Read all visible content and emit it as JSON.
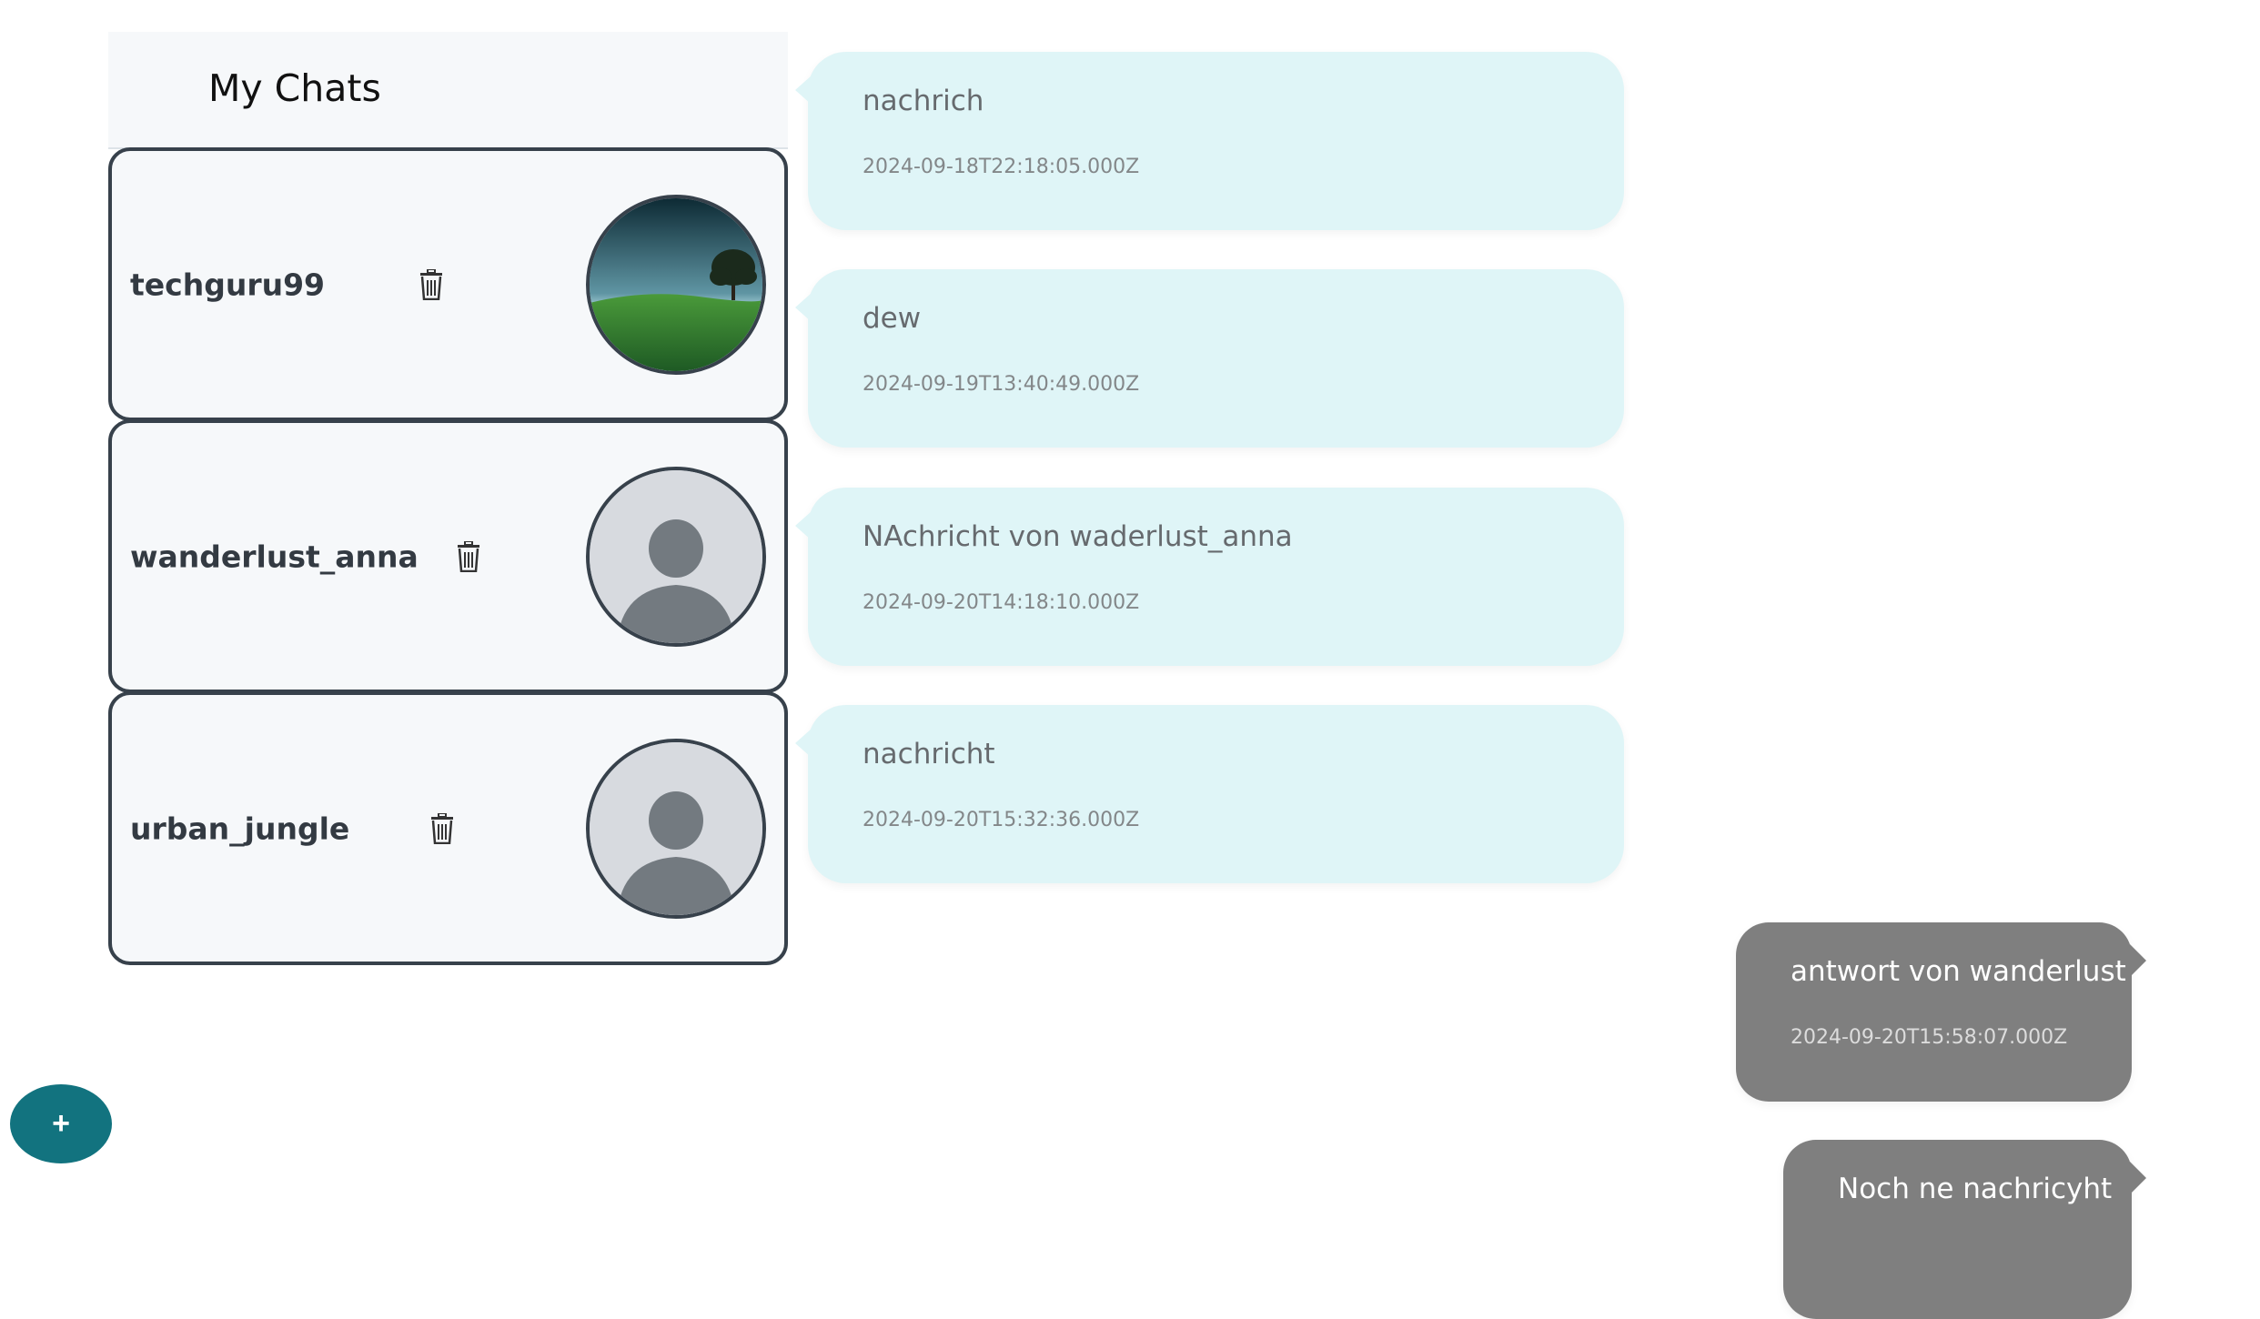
{
  "sidebar": {
    "title": "My Chats",
    "chats": [
      {
        "name": "techguru99",
        "avatar": "landscape-photo"
      },
      {
        "name": "wanderlust_anna",
        "avatar": "default-user"
      },
      {
        "name": "urban_jungle",
        "avatar": "default-user"
      }
    ]
  },
  "messages": [
    {
      "direction": "incoming",
      "text": "nachrich",
      "time": "2024-09-18T22:18:05.000Z"
    },
    {
      "direction": "incoming",
      "text": "dew",
      "time": "2024-09-19T13:40:49.000Z"
    },
    {
      "direction": "incoming",
      "text": "NAchricht von waderlust_anna",
      "time": "2024-09-20T14:18:10.000Z"
    },
    {
      "direction": "incoming",
      "text": "nachricht",
      "time": "2024-09-20T15:32:36.000Z"
    },
    {
      "direction": "outgoing",
      "text": "antwort von wanderlust",
      "time": "2024-09-20T15:58:07.000Z"
    },
    {
      "direction": "outgoing",
      "text": "Noch ne nachricyht",
      "time": ""
    }
  ],
  "fab": {
    "label": "+"
  },
  "colors": {
    "incoming_bubble": "#dff5f7",
    "outgoing_bubble": "#7f7f7f",
    "fab": "#12737f",
    "card_border": "#37414b"
  },
  "icons": {
    "delete": "trash-icon",
    "new_chat": "plus-icon"
  }
}
